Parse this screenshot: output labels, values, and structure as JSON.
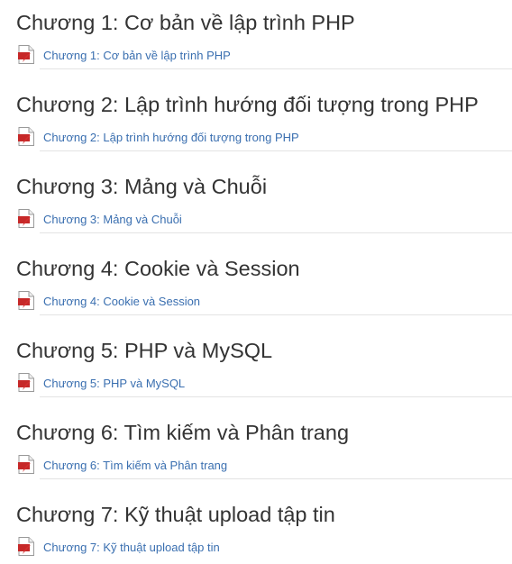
{
  "chapters": [
    {
      "title": "Chương 1: Cơ bản về lập trình PHP",
      "file_label": "Chương 1: Cơ bản về lập trình PHP",
      "icon": "pdf-file-icon"
    },
    {
      "title": "Chương 2: Lập trình hướng đối tượng trong PHP",
      "file_label": "Chương 2: Lập trình hướng đối tượng trong PHP",
      "icon": "pdf-file-icon"
    },
    {
      "title": "Chương 3: Mảng và Chuỗi",
      "file_label": "Chương 3: Mảng và Chuỗi",
      "icon": "pdf-file-icon"
    },
    {
      "title": "Chương 4: Cookie và Session",
      "file_label": "Chương 4: Cookie và Session",
      "icon": "pdf-file-icon"
    },
    {
      "title": "Chương 5: PHP và MySQL",
      "file_label": "Chương 5: PHP và MySQL",
      "icon": "pdf-file-icon"
    },
    {
      "title": "Chương 6: Tìm kiếm và Phân trang",
      "file_label": "Chương 6: Tìm kiếm và Phân trang",
      "icon": "pdf-file-icon"
    },
    {
      "title": "Chương 7: Kỹ thuật upload tập tin",
      "file_label": "Chương 7: Kỹ thuật upload tập tin",
      "icon": "pdf-file-icon"
    }
  ],
  "colors": {
    "title": "#333333",
    "link": "#3a6fb0",
    "divider": "#e3e3e3",
    "pdf_red": "#d32f2f"
  }
}
